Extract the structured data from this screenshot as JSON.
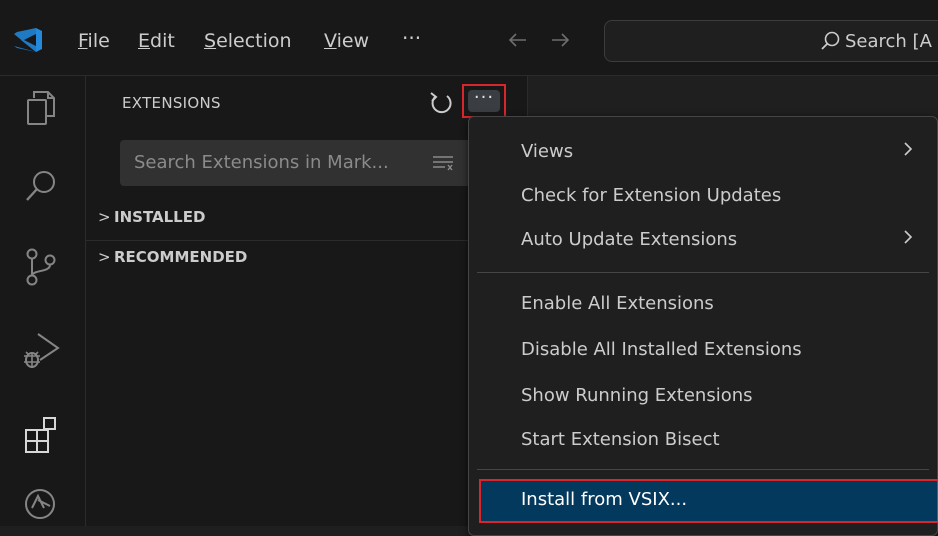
{
  "titlebar": {
    "menu": [
      {
        "label_prefix": "",
        "mnemonic": "F",
        "label_rest": "ile"
      },
      {
        "label_prefix": "",
        "mnemonic": "E",
        "label_rest": "dit"
      },
      {
        "label_prefix": "",
        "mnemonic": "S",
        "label_rest": "election"
      },
      {
        "label_prefix": "",
        "mnemonic": "V",
        "label_rest": "iew"
      }
    ],
    "overflow_label": "···",
    "search_text": "Search [A",
    "accent_color": "#2489db"
  },
  "activitybar": {
    "icons": [
      "explorer-icon",
      "search-icon",
      "source-control-icon",
      "run-debug-icon",
      "extensions-icon",
      "remote-icon"
    ]
  },
  "sidebar": {
    "title": "EXTENSIONS",
    "more_label": "···",
    "search_placeholder": "Search Extensions in Mark...",
    "sections": [
      {
        "label": "INSTALLED",
        "chevron": ">"
      },
      {
        "label": "RECOMMENDED",
        "chevron": ">"
      }
    ]
  },
  "context_menu": {
    "groups": [
      [
        {
          "label": "Views",
          "submenu": true
        },
        {
          "label": "Check for Extension Updates",
          "submenu": false
        },
        {
          "label": "Auto Update Extensions",
          "submenu": true
        }
      ],
      [
        {
          "label": "Enable All Extensions",
          "submenu": false
        },
        {
          "label": "Disable All Installed Extensions",
          "submenu": false
        },
        {
          "label": "Show Running Extensions",
          "submenu": false
        },
        {
          "label": "Start Extension Bisect",
          "submenu": false
        }
      ],
      [
        {
          "label": "Install from VSIX...",
          "submenu": false,
          "highlighted": true
        }
      ]
    ],
    "highlight_color": "#04395e",
    "annotation_color": "#d9262c"
  }
}
